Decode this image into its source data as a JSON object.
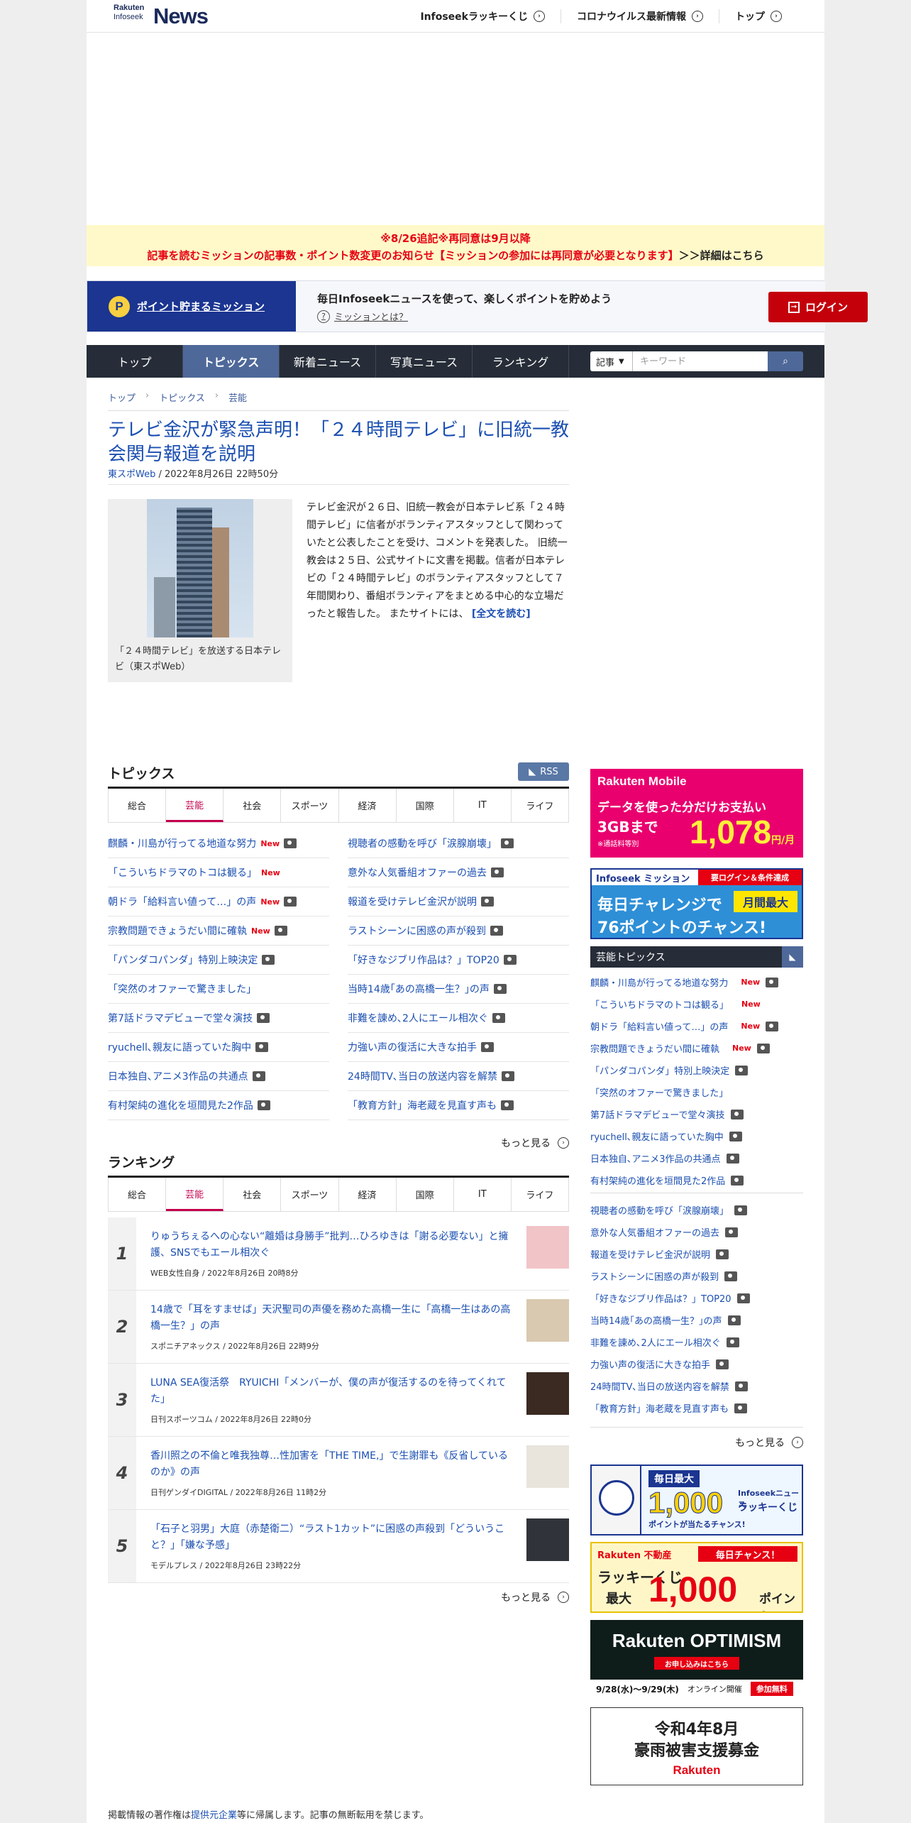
{
  "header": {
    "logo_line1": "Rakuten",
    "logo_line2": "Infoseek",
    "logo_news": "News",
    "nav": [
      "Infoseekラッキーくじ",
      "コロナウイルス最新情報",
      "トップ"
    ]
  },
  "notice": {
    "line1": "※8/26追記※再同意は9月以降",
    "line2": "記事を読むミッションの記事数・ポイント数変更のお知らせ【ミッションの参加には再同意が必要となります】",
    "link": "＞＞詳細はこちら"
  },
  "mission": {
    "coin": "P",
    "title": "ポイント貯まるミッション",
    "headline": "毎日Infoseekニュースを使って、楽しくポイントを貯めよう",
    "help": "ミッションとは？",
    "login": "ログイン"
  },
  "gnav": {
    "tabs": [
      "トップ",
      "トピックス",
      "新着ニュース",
      "写真ニュース",
      "ランキング"
    ],
    "search_select": "記事",
    "search_placeholder": "キーワード"
  },
  "breadcrumb": [
    "トップ",
    "トピックス",
    "芸能"
  ],
  "article": {
    "title": "テレビ金沢が緊急声明！「２４時間テレビ」に旧統一教会関与報道を説明",
    "source": "東スポWeb",
    "date": " / 2022年8月26日 22時50分",
    "caption": "「２４時間テレビ」を放送する日本テレビ（東スポWeb）",
    "body": "テレビ金沢が２６日、旧統一教会が日本テレビ系「２４時間テレビ」に信者がボランティアスタッフとして関わっていたと公表したことを受け、コメントを発表した。 旧統一教会は２５日、公式サイトに文書を掲載。信者が日本テレビの「２４時間テレビ」のボランティアスタッフとして７年間関わり、番組ボランティアをまとめる中心的な立場だったと報告した。 またサイトには、",
    "readmore": "[全文を読む]"
  },
  "topics": {
    "title": "トピックス",
    "rss": "RSS",
    "tabs": [
      "総合",
      "芸能",
      "社会",
      "スポーツ",
      "経済",
      "国際",
      "IT",
      "ライフ"
    ],
    "left": [
      {
        "t": "麒麟・川島が行ってる地道な努力",
        "new": "New",
        "cam": true
      },
      {
        "t": "「こういちドラマのトコは観る」",
        "new": "New",
        "cam": false
      },
      {
        "t": "朝ドラ「給料言い値って…」の声",
        "new": "New",
        "cam": true
      },
      {
        "t": "宗教問題できょうだい間に確執",
        "new": "New",
        "cam": true
      },
      {
        "t": "「パンダコパンダ」特別上映決定",
        "new": "",
        "cam": true
      },
      {
        "t": "「突然のオファーで驚きました」",
        "new": "",
        "cam": false
      },
      {
        "t": "第7話ドラマデビューで堂々演技",
        "new": "",
        "cam": true
      },
      {
        "t": "ryuchell､親友に語っていた胸中",
        "new": "",
        "cam": true
      },
      {
        "t": "日本独自､アニメ3作品の共通点",
        "new": "",
        "cam": true
      },
      {
        "t": "有村架純の進化を垣間見た2作品",
        "new": "",
        "cam": true
      }
    ],
    "right": [
      {
        "t": "視聴者の感動を呼び「涙腺崩壊」",
        "cam": true
      },
      {
        "t": "意外な人気番組オファーの過去",
        "cam": true
      },
      {
        "t": "報道を受けテレビ金沢が説明",
        "cam": true
      },
      {
        "t": "ラストシーンに困惑の声が殺到",
        "cam": true
      },
      {
        "t": "「好きなジブリ作品は？」TOP20",
        "cam": true
      },
      {
        "t": "当時14歳｢あの高橋一生？｣の声",
        "cam": true
      },
      {
        "t": "非難を諌め､2人にエール相次ぐ",
        "cam": true
      },
      {
        "t": "力強い声の復活に大きな拍手",
        "cam": true
      },
      {
        "t": "24時間TV､当日の放送内容を解禁",
        "cam": true
      },
      {
        "t": "「教育方針」海老蔵を見直す声も",
        "cam": true
      }
    ],
    "more": "もっと見る"
  },
  "ranking": {
    "title": "ランキング",
    "tabs": [
      "総合",
      "芸能",
      "社会",
      "スポーツ",
      "経済",
      "国際",
      "IT",
      "ライフ"
    ],
    "items": [
      {
        "n": "1",
        "t": "りゅうちぇるへの心ない“離婚は身勝手”批判…ひろゆきは「謝る必要ない」と擁護、SNSでもエール相次ぐ",
        "s": "WEB女性自身 / 2022年8月26日 20時8分"
      },
      {
        "n": "2",
        "t": "14歳で「耳をすませば」天沢聖司の声優を務めた高橋一生に「高橋一生はあの高橋一生？」の声",
        "s": "スポニチアネックス / 2022年8月26日 22時9分"
      },
      {
        "n": "3",
        "t": "LUNA SEA復活祭　RYUICHI「メンバーが、僕の声が復活するのを待ってくれてた」",
        "s": "日刊スポーツコム / 2022年8月26日 22時0分"
      },
      {
        "n": "4",
        "t": "香川照之の不倫と唯我独尊…性加害を「THE TIME,」で生謝罪も《反省しているのか》の声",
        "s": "日刊ゲンダイDIGITAL / 2022年8月26日 11時2分"
      },
      {
        "n": "5",
        "t": "「石子と羽男」大庭（赤楚衛二）“ラスト1カット”に困惑の声殺到「どういうこと？」「嫌な予感」",
        "s": "モデルプレス / 2022年8月26日 23時22分"
      }
    ],
    "more": "もっと見る"
  },
  "sidebar": {
    "ad1": {
      "brand": "Rakuten Mobile",
      "l1": "データを使った分だけお支払い",
      "l2": "3GBまで",
      "l3": "※通話料等別",
      "price": "1,078",
      "unit": "円/月"
    },
    "ad2": {
      "tag": "Infoseek ミッション",
      "cond": "要ログイン＆条件達成",
      "l1": "毎日チャレンジで",
      "l2": "76ポイントのチャンス!",
      "badge": "月間最大"
    },
    "topics_title": "芸能トピックス",
    "ad3": {
      "a": "毎日最大",
      "b": "1,000",
      "c": "ポイントが当たるチャンス!",
      "d": "Infoseekニュース",
      "e": "ラッキーくじ"
    },
    "ad4": {
      "a": "Rakuten 不動産",
      "b": "毎日チャンス！",
      "c": "ラッキーくじ",
      "d": "最大",
      "e": "1,000",
      "f": "ポイント"
    },
    "ad5": {
      "a": "Rakuten OPTIMISM",
      "b": "お申し込みはこちら",
      "c": "9/28(水)〜9/29(木)",
      "d": "オンライン開催",
      "e": "参加無料"
    },
    "ad6": {
      "a": "令和4年8月",
      "b": "豪雨被害支援募金",
      "c": "Rakuten"
    }
  },
  "footer": {
    "pre": "掲載情報の著作権は",
    "link": "提供元企業",
    "post": "等に帰属します。記事の無断転用を禁じます。"
  },
  "colors": {
    "brand": "#1b3591",
    "accent_red": "#e60012",
    "nav": "#262d38",
    "link": "#1b4fb1"
  }
}
